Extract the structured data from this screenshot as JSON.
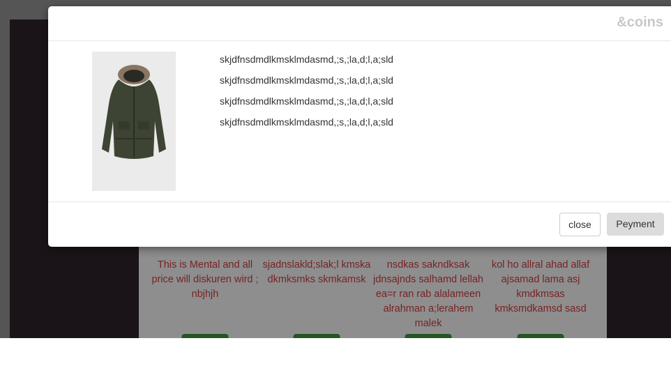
{
  "modal": {
    "title": "&coins",
    "description_lines": [
      "skjdfnsdmdlkmsklmdasmd,;s,;la,d;l,a;sld",
      "skjdfnsdmdlkmsklmdasmd,;s,;la,d;l,a;sld",
      "skjdfnsdmdlkmsklmdasmd,;s,;la,d;l,a;sld",
      "skjdfnsdmdlkmsklmdasmd,;s,;la,d;l,a;sld"
    ],
    "product_image": "jacket-image",
    "close_label": "close",
    "payment_label": "Peyment"
  },
  "cards": [
    {
      "text": "This is Mental and all price will diskuren wird ; nbjhjh"
    },
    {
      "text": "sjadnslakld;slak;l kmska dkmksmks skmkamsk"
    },
    {
      "text": "nsdkas sakndksak jdnsajnds salhamd lellah ea=r ran rab alalameen alrahman a;lerahem malek"
    },
    {
      "text": "kol ho allral ahad allaf ajsamad lama asj kmdkmsas kmksmdkamsd sasd"
    }
  ],
  "colors": {
    "card_text": "#c0383a",
    "card_button": "#3d8a3d",
    "dark_panel": "#2a2128"
  }
}
